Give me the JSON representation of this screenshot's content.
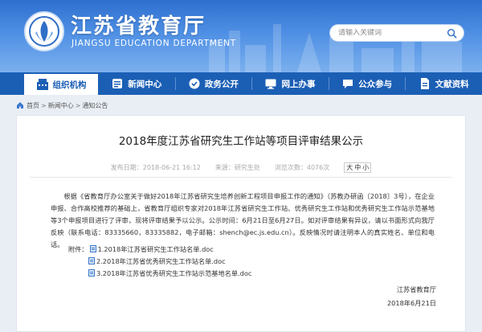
{
  "header": {
    "title": "江苏省教育厅",
    "subtitle": "JIANGSU EDUCATION DEPARTMENT",
    "search_placeholder": "请输入关键词"
  },
  "nav": {
    "items": [
      {
        "label": "组织机构",
        "icon": "org-icon"
      },
      {
        "label": "新闻中心",
        "icon": "news-icon"
      },
      {
        "label": "政务公开",
        "icon": "gov-icon"
      },
      {
        "label": "网上办事",
        "icon": "online-icon"
      },
      {
        "label": "公众参与",
        "icon": "public-icon"
      },
      {
        "label": "文献资料",
        "icon": "docs-icon"
      }
    ]
  },
  "breadcrumb": {
    "items": [
      "首页",
      "新闻中心",
      "通知公告"
    ],
    "sep": ">"
  },
  "article": {
    "title": "2018年度江苏省研究生工作站等项目评审结果公示",
    "date": "发布日期：2018-06-21 16:12",
    "source": "来源：研究生处",
    "views": "浏览次数：4076次",
    "font_sizes": [
      "大",
      "中",
      "小"
    ],
    "body": "根据《省教育厅办公室关于做好2018年江苏省研究生培养创新工程项目申报工作的通知》（苏教办研函〔2018〕3号），在企业申报、合作高校推荐的基础上，省教育厅组织专家对2018年江苏省研究生工作站、优秀研究生工作站和优秀研究生工作站示范基地等3个申报项目进行了评审，现将评审结果予以公示。公示时间：6月21日至6月27日。如对评审结果有异议，请以书面形式向我厅反映（联系电话：83335660，83335882，电子邮箱：shench@ec.js.edu.cn）。反映情况时请注明本人的真实姓名、单位和电话。",
    "attachment_label": "附件：",
    "attachments": [
      "1.2018年江苏省研究生工作站名单.doc",
      "2.2018年江苏省优秀研究生工作站名单.doc",
      "3.2018年江苏省优秀研究生工作站示范基地名单.doc"
    ],
    "signature_org": "江苏省教育厅",
    "signature_date": "2018年6月21日"
  }
}
